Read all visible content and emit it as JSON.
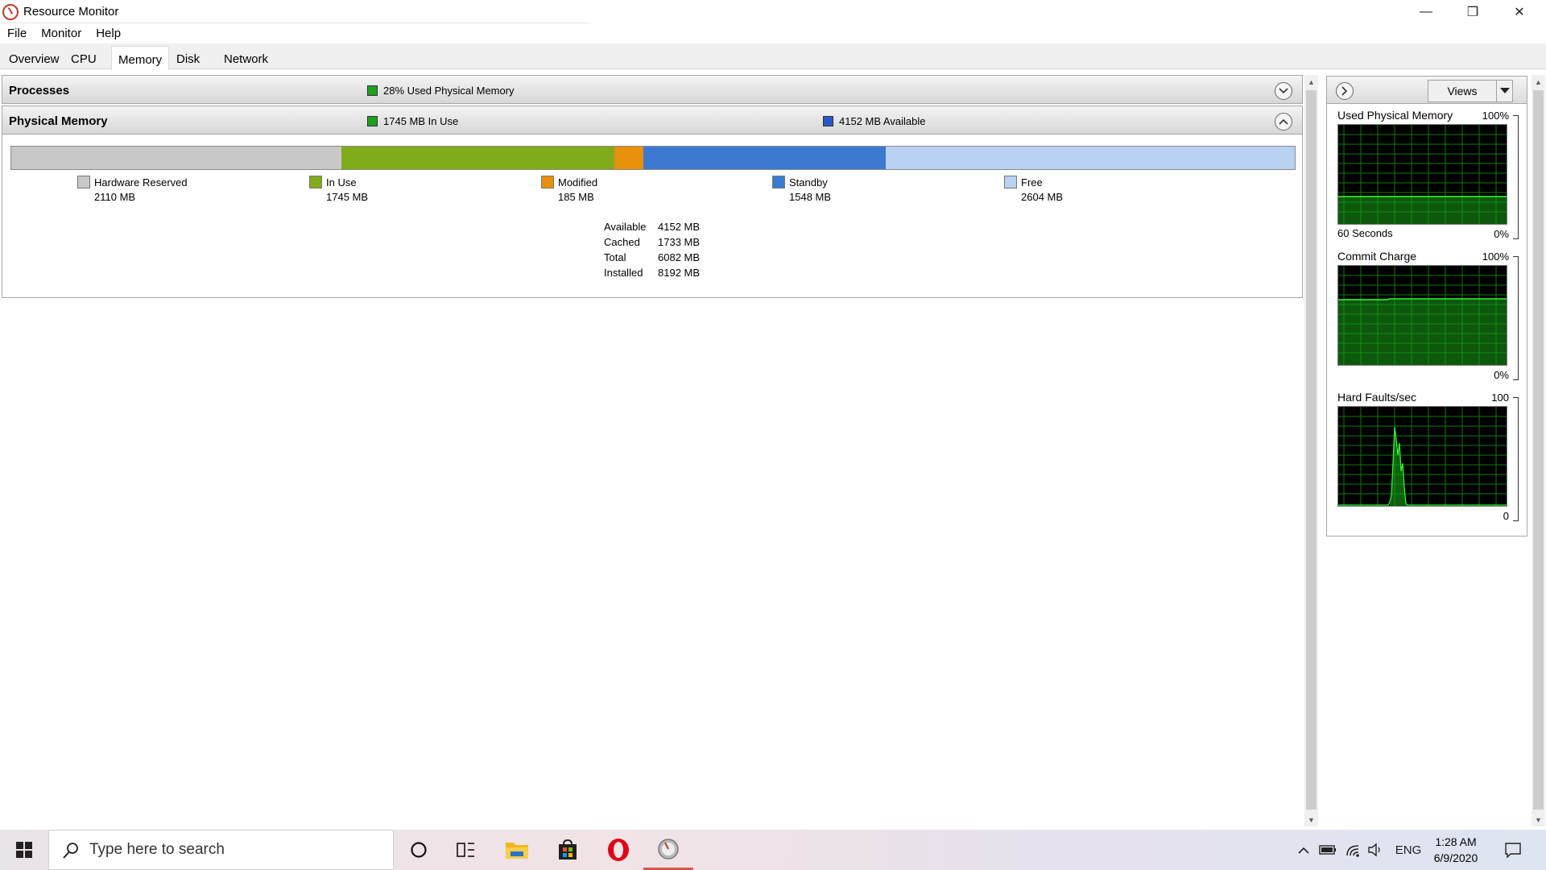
{
  "window": {
    "title": "Resource Monitor",
    "controls": {
      "minimize": "—",
      "maximize": "❐",
      "close": "✕"
    }
  },
  "menu": {
    "items": [
      "File",
      "Monitor",
      "Help"
    ]
  },
  "tabs": {
    "items": [
      "Overview",
      "CPU",
      "Memory",
      "Disk",
      "Network"
    ],
    "active": "Memory"
  },
  "processes": {
    "title": "Processes",
    "stat": "28% Used Physical Memory",
    "stat_color": "#1fa01f"
  },
  "physical_memory": {
    "title": "Physical Memory",
    "in_use_stat": "1745 MB In Use",
    "available_stat": "4152 MB Available",
    "in_use_color": "#1fa01f",
    "available_color": "#2c56c8",
    "legend": [
      {
        "name": "Hardware Reserved",
        "value": "2110 MB",
        "color": "#c8c8c8"
      },
      {
        "name": "In Use",
        "value": "1745 MB",
        "color": "#80ab1a"
      },
      {
        "name": "Modified",
        "value": "185 MB",
        "color": "#e88f0c"
      },
      {
        "name": "Standby",
        "value": "1548 MB",
        "color": "#3c7ad2"
      },
      {
        "name": "Free",
        "value": "2604 MB",
        "color": "#b9d2f1"
      }
    ],
    "summary": {
      "available_label": "Available",
      "available_value": "4152 MB",
      "cached_label": "Cached",
      "cached_value": "1733 MB",
      "total_label": "Total",
      "total_value": "6082 MB",
      "installed_label": "Installed",
      "installed_value": "8192 MB"
    }
  },
  "right_pane": {
    "views_label": "Views",
    "graphs": [
      {
        "title": "Used Physical Memory",
        "max": "100%",
        "footer_left": "60 Seconds",
        "footer_right": "0%"
      },
      {
        "title": "Commit Charge",
        "max": "100%",
        "footer_left": "",
        "footer_right": "0%"
      },
      {
        "title": "Hard Faults/sec",
        "max": "100",
        "footer_left": "",
        "footer_right": "0"
      }
    ]
  },
  "taskbar": {
    "search_placeholder": "Type here to search",
    "apps": [
      "cortana-icon",
      "task-view-icon",
      "file-explorer-icon",
      "store-icon",
      "opera-icon",
      "resource-monitor-icon"
    ],
    "language": "ENG",
    "time": "1:28 AM",
    "date": "6/9/2020"
  }
}
